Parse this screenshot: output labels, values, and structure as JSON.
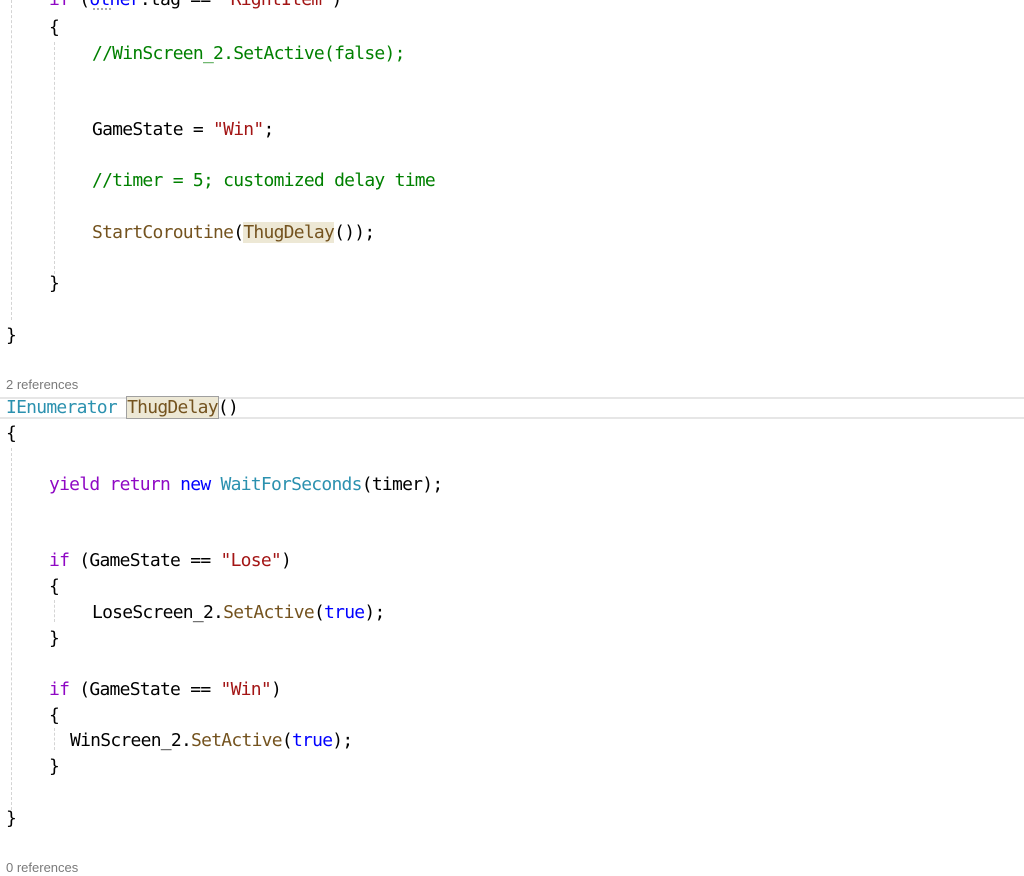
{
  "editor": {
    "lines": {
      "if_tag_prefix": "if (",
      "if_tag_var": "other",
      "if_tag_rest": ".tag == ",
      "if_tag_str": "\"RightItem\"",
      "if_tag_close": ")",
      "open_brace": "{",
      "close_brace": "}",
      "comment_winscreen": "//WinScreen_2.SetActive(false);",
      "gamestate_assign_lhs": "GameState = ",
      "gamestate_assign_str": "\"Win\"",
      "semicolon": ";",
      "comment_timer": "//timer = 5; customized delay time",
      "start_coroutine": "StartCoroutine",
      "paren_open": "(",
      "thugdelay_name": "ThugDelay",
      "call_tail": "());",
      "method_type": "IEnumerator",
      "space": " ",
      "method_parens": "()",
      "yield_kw": "yield",
      "return_kw": "return",
      "new_kw": "new",
      "wait_type": "WaitForSeconds",
      "wait_args": "(timer);",
      "if_kw": "if",
      "cond_open": " (GameState == ",
      "lose_str": "\"Lose\"",
      "win_str": "\"Win\"",
      "cond_close": ")",
      "lose_obj": "LoseScreen_2.",
      "set_active": "SetActive",
      "true_kw": "true",
      "stmt_close": ");",
      "win_obj": "WinScreen_2."
    },
    "codelens": {
      "thugdelay_refs": "2 references",
      "next_refs": "0 references"
    }
  }
}
